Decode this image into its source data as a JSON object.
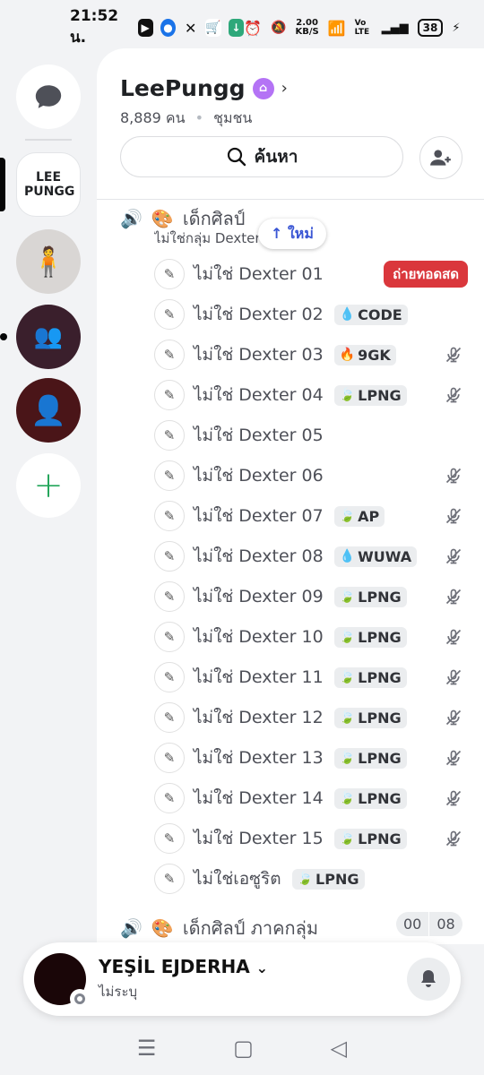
{
  "status_bar": {
    "time": "21:52 น.",
    "net_speed_value": "2.00",
    "net_speed_unit": "KB/S",
    "volte": "Vo LTE",
    "battery": "38"
  },
  "server": {
    "name": "LeePungg",
    "subtitle_count": "8,889 คน",
    "subtitle_type": "ชุมชน",
    "rail_logo_text": "LEE PUNGG"
  },
  "search": {
    "label": "ค้นหา"
  },
  "new_pill": {
    "label": "↑ ใหม่"
  },
  "channel1": {
    "name": "เด็กศิลป์",
    "subtitle": "ไม่ใช่กลุ่ม Dexter"
  },
  "channel2": {
    "name": "เด็กศิลป์ ภาคกลุ่ม",
    "time_a": "00",
    "time_b": "08"
  },
  "live_badge": "ถ่ายทอดสด",
  "members": [
    {
      "name": "ไม่ใช่ Dexter 01",
      "tag": "",
      "tag_icon": "",
      "muted": false
    },
    {
      "name": "ไม่ใช่ Dexter 02",
      "tag": "CODE",
      "tag_icon": "💧",
      "muted": false
    },
    {
      "name": "ไม่ใช่ Dexter 03",
      "tag": "9GK",
      "tag_icon": "🔥",
      "muted": true
    },
    {
      "name": "ไม่ใช่ Dexter 04",
      "tag": "LPNG",
      "tag_icon": "🍃",
      "muted": true
    },
    {
      "name": "ไม่ใช่ Dexter 05",
      "tag": "",
      "tag_icon": "",
      "muted": false
    },
    {
      "name": "ไม่ใช่ Dexter 06",
      "tag": "",
      "tag_icon": "",
      "muted": true
    },
    {
      "name": "ไม่ใช่ Dexter 07",
      "tag": "AP",
      "tag_icon": "🍃",
      "muted": true
    },
    {
      "name": "ไม่ใช่ Dexter 08",
      "tag": "WUWA",
      "tag_icon": "💧",
      "muted": true
    },
    {
      "name": "ไม่ใช่ Dexter 09",
      "tag": "LPNG",
      "tag_icon": "🍃",
      "muted": true
    },
    {
      "name": "ไม่ใช่ Dexter 10",
      "tag": "LPNG",
      "tag_icon": "🍃",
      "muted": true
    },
    {
      "name": "ไม่ใช่ Dexter 11",
      "tag": "LPNG",
      "tag_icon": "🍃",
      "muted": true
    },
    {
      "name": "ไม่ใช่ Dexter 12",
      "tag": "LPNG",
      "tag_icon": "🍃",
      "muted": true
    },
    {
      "name": "ไม่ใช่ Dexter 13",
      "tag": "LPNG",
      "tag_icon": "🍃",
      "muted": true
    },
    {
      "name": "ไม่ใช่ Dexter 14",
      "tag": "LPNG",
      "tag_icon": "🍃",
      "muted": true
    },
    {
      "name": "ไม่ใช่ Dexter 15",
      "tag": "LPNG",
      "tag_icon": "🍃",
      "muted": true
    },
    {
      "name": "ไม่ใช่เอซูริต",
      "tag": "LPNG",
      "tag_icon": "🍃",
      "muted": false
    }
  ],
  "user": {
    "name": "YEŞİL EJDERHA",
    "status": "ไม่ระบุ"
  },
  "colors": {
    "live": "#da373c",
    "online_add": "#23a55a",
    "boost": "#b473f5",
    "new_pill_text": "#3a56d4"
  }
}
